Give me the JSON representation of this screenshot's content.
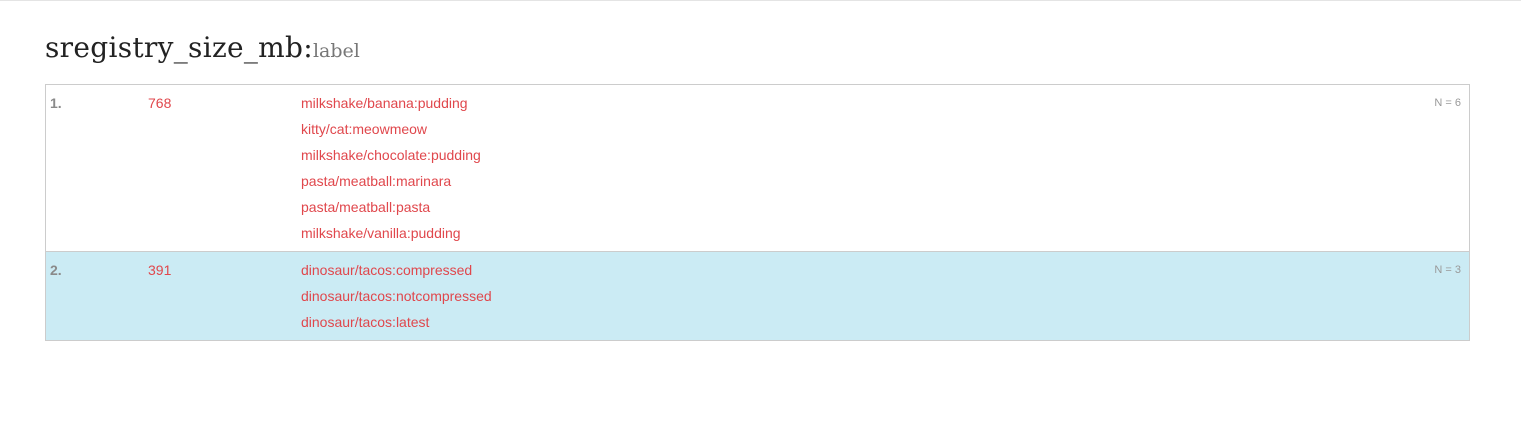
{
  "page": {
    "title": "sregistry_size_mb:",
    "subtitle": "label"
  },
  "results": [
    {
      "rank": "1.",
      "size": "768",
      "count": "N = 6",
      "containers": [
        "milkshake/banana:pudding",
        "kitty/cat:meowmeow",
        "milkshake/chocolate:pudding",
        "pasta/meatball:marinara",
        "pasta/meatball:pasta",
        "milkshake/vanilla:pudding"
      ]
    },
    {
      "rank": "2.",
      "size": "391",
      "count": "N = 3",
      "containers": [
        "dinosaur/tacos:compressed",
        "dinosaur/tacos:notcompressed",
        "dinosaur/tacos:latest"
      ]
    }
  ],
  "colors": {
    "link": "#e0474c",
    "highlight_row": "#cbebf4",
    "border": "#cccccc"
  }
}
